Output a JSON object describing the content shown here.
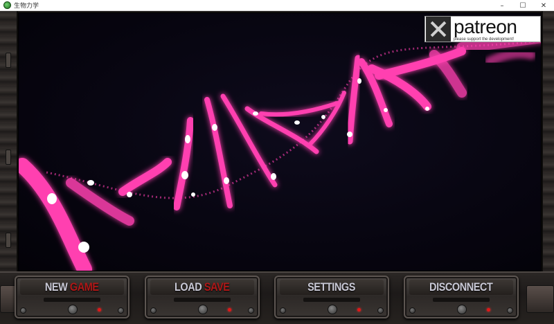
{
  "window": {
    "title": "生物力学",
    "controls": {
      "minimize": "–",
      "maximize": "☐",
      "close": "✕"
    }
  },
  "patreon": {
    "word": "patreon",
    "tagline": "please support the development!"
  },
  "menu": {
    "buttons": [
      {
        "label_main": "NEW ",
        "label_accent": "GAME"
      },
      {
        "label_main": "LOAD ",
        "label_accent": "SAVE"
      },
      {
        "label_main": "SETTINGS",
        "label_accent": ""
      },
      {
        "label_main": "DISCONNECT",
        "label_accent": ""
      }
    ]
  },
  "colors": {
    "dna_pink": "#ff3fb0",
    "dna_white": "#ffffff",
    "accent_red": "#b01818",
    "label_gray": "#c9c9d6",
    "background": "#070510"
  },
  "icons": {
    "app": "app-icon",
    "patreon_logo": "patreon-logo-icon"
  }
}
